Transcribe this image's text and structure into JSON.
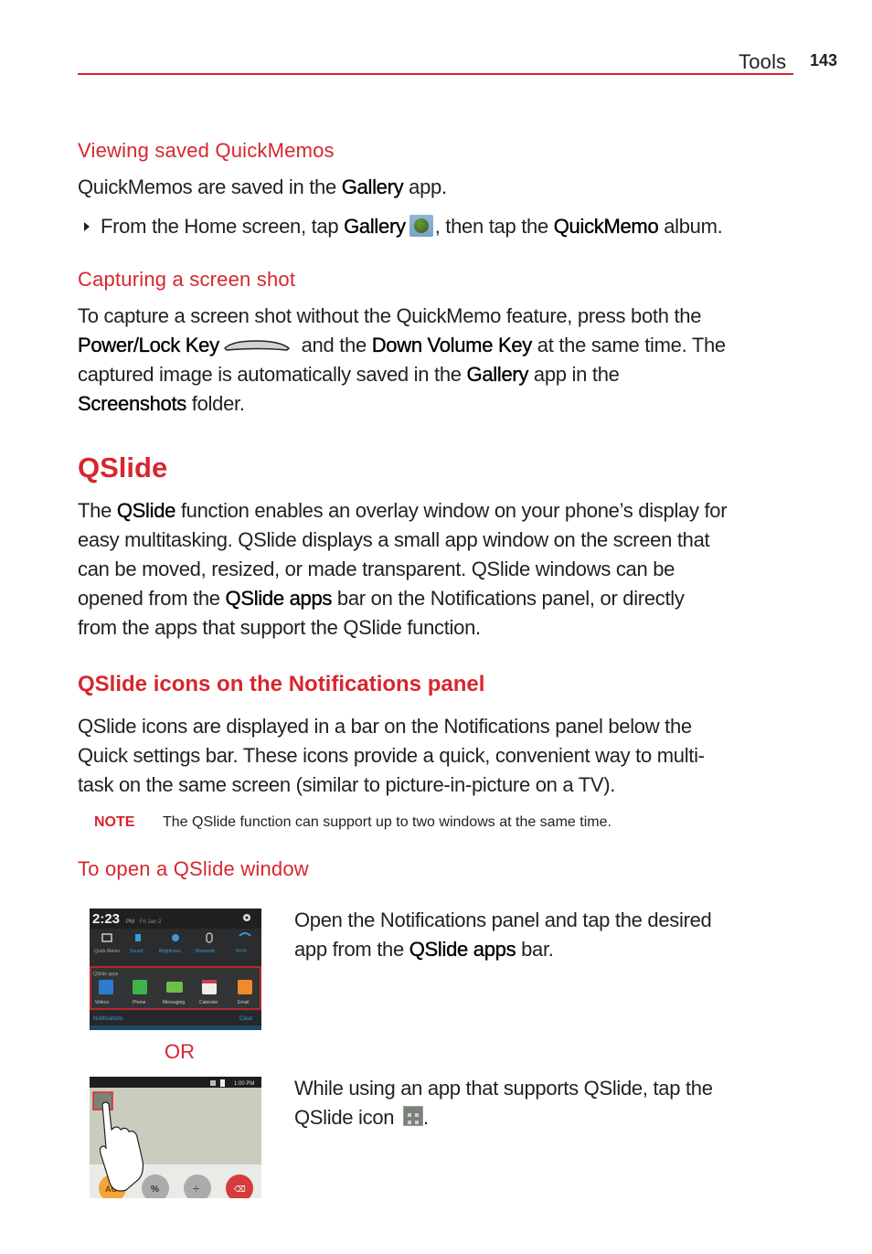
{
  "header": {
    "section": "Tools",
    "page_number": "143"
  },
  "viewing_saved": {
    "heading": "Viewing saved QuickMemos",
    "intro": {
      "pre": "QuickMemos are saved in the ",
      "em": "Gallery",
      "post": " app."
    },
    "bullet": {
      "pre": "From the Home screen, tap ",
      "em1": "Gallery",
      "icon": "gallery-icon",
      "mid": ", then tap the ",
      "em2": "QuickMemo",
      "post": " album."
    }
  },
  "capturing": {
    "heading": "Capturing a screen shot",
    "line1": "To capture a screen shot without the QuickMemo feature, press both the",
    "line2": {
      "em1": "Power/Lock Key",
      "icon": "power-lock-key-icon",
      "mid": " and the ",
      "em2": "Down Volume Key",
      "post": " at the same time. The"
    },
    "line3": {
      "pre": "captured image is automatically saved in the ",
      "em": "Gallery",
      "post": " app in the"
    },
    "line4": {
      "em": "Screenshots",
      "post": " folder."
    }
  },
  "qslide": {
    "title": "QSlide",
    "line1": {
      "pre": "The ",
      "em": "QSlide",
      "post": " function enables an overlay window on your phone’s display for"
    },
    "line2": "easy multitasking. QSlide displays a small app window on the screen that",
    "line3": "can be moved, resized, or made transparent. QSlide windows can be",
    "line4": {
      "pre": "opened from the ",
      "em": "QSlide apps",
      "post": " bar on the Notifications panel, or directly"
    },
    "line5": "from the apps that support the QSlide function."
  },
  "icons_section": {
    "heading": "QSlide icons on the Notifications panel",
    "line1": "QSlide icons are displayed in a bar on the Notifications panel below the",
    "line2": "Quick settings bar. These icons provide a quick, convenient way to multi-",
    "line3": "task on the same screen (similar to picture-in-picture on a TV).",
    "note_label": "NOTE",
    "note_text": "The QSlide function can support up to two windows at the same time."
  },
  "open_window": {
    "heading": "To open a QSlide window",
    "step1": {
      "line1": "Open the Notifications panel and tap the desired",
      "line2": {
        "pre": "app from the ",
        "em": "QSlide apps",
        "post": " bar."
      }
    },
    "or_label": "OR",
    "step2": {
      "line1": "While using an app that supports QSlide, tap the",
      "line2": {
        "pre": "QSlide icon ",
        "icon": "qslide-icon",
        "post": "."
      }
    }
  },
  "screenshot1": {
    "time": "2:23",
    "ampm": "PM",
    "date": "Fri Jan 2",
    "quick_settings": [
      "Quick Memo",
      "Sound",
      "Brightness",
      "Bluetooth",
      "Wi-Fi"
    ],
    "qslide_label": "QSlide apps",
    "qslide_apps": [
      "Videos",
      "Phone",
      "Messaging",
      "Calendar",
      "Email"
    ],
    "notifications_label": "Notifications",
    "clear_label": "Clear"
  },
  "screenshot2": {
    "clock": "1:00 PM",
    "buttons": [
      "AC",
      "%",
      "÷",
      "⌫"
    ]
  },
  "colors": {
    "accent": "#d7262e",
    "text": "#231f20"
  }
}
